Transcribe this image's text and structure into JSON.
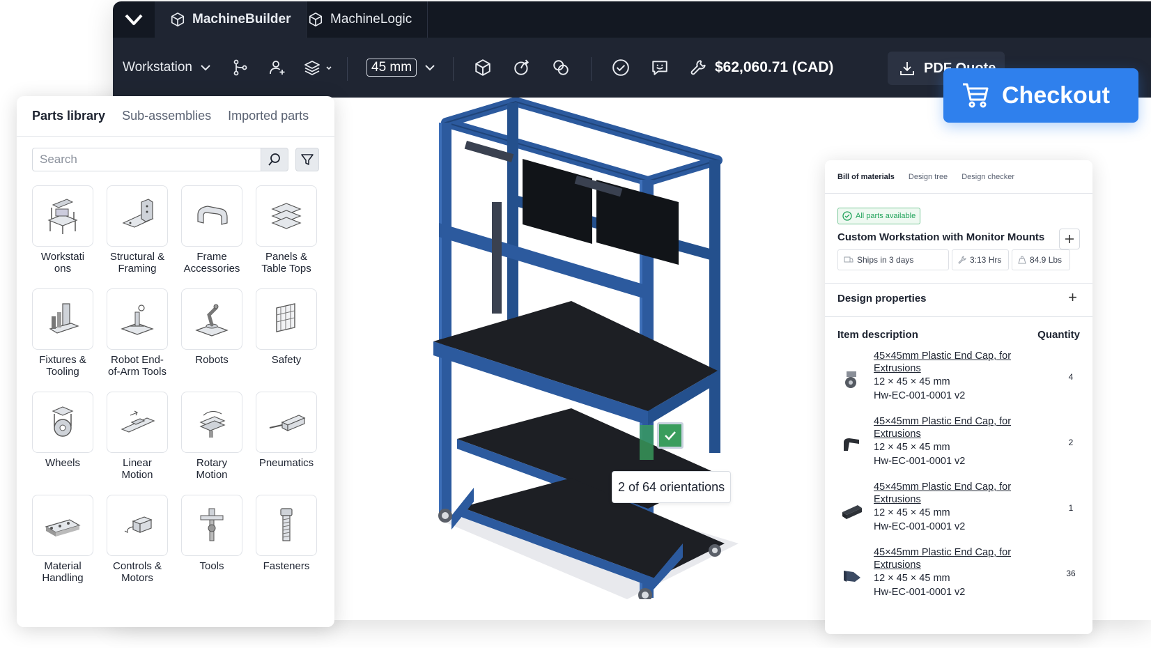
{
  "app": {
    "tabs": [
      {
        "label": "MachineBuilder",
        "active": true
      },
      {
        "label": "MachineLogic",
        "active": false
      }
    ]
  },
  "toolbar": {
    "workstation_label": "Workstation",
    "unit_value": "45 mm",
    "price": "$62,060.71 (CAD)",
    "pdf_quote_label": "PDF Quote"
  },
  "checkout": {
    "label": "Checkout"
  },
  "parts_library": {
    "tabs": [
      "Parts library",
      "Sub-assemblies",
      "Imported parts"
    ],
    "search_placeholder": "Search",
    "categories": [
      {
        "label": "Workstati\nons",
        "icon": "workstation-icon"
      },
      {
        "label": "Structural &\nFraming",
        "icon": "structural-framing-icon"
      },
      {
        "label": "Frame\nAccessories",
        "icon": "frame-accessory-icon"
      },
      {
        "label": "Panels &\nTable Tops",
        "icon": "panels-icon"
      },
      {
        "label": "Fixtures &\nTooling",
        "icon": "fixture-icon"
      },
      {
        "label": "Robot End-\nof-Arm Tools",
        "icon": "end-effector-icon"
      },
      {
        "label": "Robots",
        "icon": "robot-icon"
      },
      {
        "label": "Safety",
        "icon": "safety-fence-icon"
      },
      {
        "label": "Wheels",
        "icon": "wheel-icon"
      },
      {
        "label": "Linear\nMotion",
        "icon": "linear-motion-icon"
      },
      {
        "label": "Rotary\nMotion",
        "icon": "rotary-motion-icon"
      },
      {
        "label": "Pneumatics",
        "icon": "pneumatic-cylinder-icon"
      },
      {
        "label": "Material\nHandling",
        "icon": "conveyor-icon"
      },
      {
        "label": "Controls &\nMotors",
        "icon": "motor-icon"
      },
      {
        "label": "Tools",
        "icon": "tool-icon"
      },
      {
        "label": "Fasteners",
        "icon": "bolt-icon"
      }
    ]
  },
  "viewport": {
    "orientation_text": "2 of 64 orientations"
  },
  "bom": {
    "tabs": [
      "Bill of materials",
      "Design tree",
      "Design checker"
    ],
    "availability": "All parts available",
    "title": "Custom Workstation with Monitor Mounts",
    "ships": "Ships in 3 days",
    "hours": "3:13 Hrs",
    "weight": "84.9 Lbs",
    "design_properties": "Design properties",
    "item_description_head": "Item description",
    "quantity_head": "Quantity",
    "items": [
      {
        "name": "45×45mm Plastic End Cap, for Extrusions",
        "dims": "12 × 45 × 45 mm",
        "sku": "Hw-EC-001-0001 v2",
        "qty": "4"
      },
      {
        "name": "45×45mm Plastic End Cap, for Extrusions",
        "dims": "12 × 45 × 45 mm",
        "sku": "Hw-EC-001-0001 v2",
        "qty": "2"
      },
      {
        "name": "45×45mm Plastic End Cap, for Extrusions",
        "dims": "12 × 45 × 45 mm",
        "sku": "Hw-EC-001-0001 v2",
        "qty": "1"
      },
      {
        "name": "45×45mm Plastic End Cap, for Extrusions",
        "dims": "12 × 45 × 45 mm",
        "sku": "Hw-EC-001-0001 v2",
        "qty": "36"
      }
    ]
  },
  "colors": {
    "topbar": "#131822",
    "toolbar": "#1f2532",
    "accent": "#2f80ed",
    "frame_blue": "#2c5a9e",
    "success": "#21a35b"
  }
}
